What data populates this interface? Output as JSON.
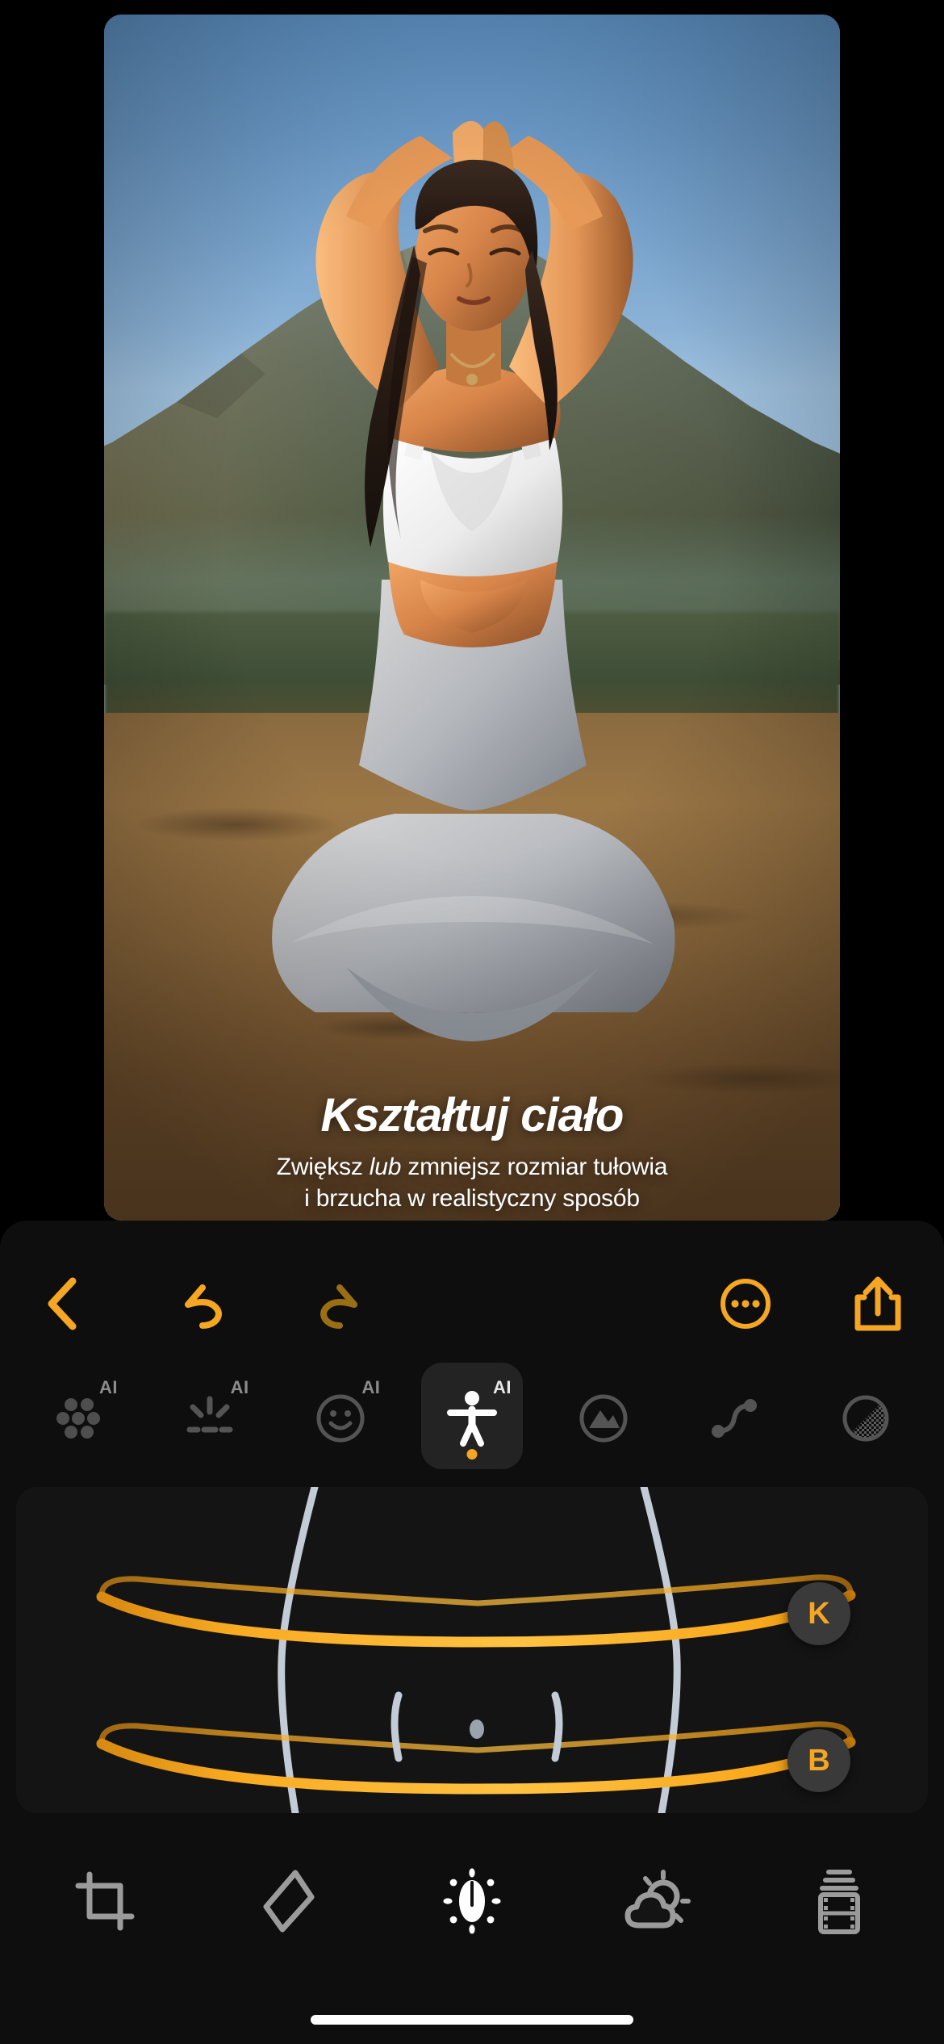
{
  "app": {
    "accent_color": "#f5a623",
    "sheet_bg": "#0e0e0e",
    "card_bg": "#141414"
  },
  "photo": {
    "caption": {
      "title": "Kształtuj ciało",
      "subtitle_line1_a": "Zwiększ ",
      "subtitle_line1_em": "lub",
      "subtitle_line1_b": " zmniejsz rozmiar tułowia",
      "subtitle_line2": "i brzucha w realistyczny sposób"
    }
  },
  "toolbar": {
    "back_label": "back-chevron",
    "undo_label": "undo",
    "redo_label": "redo",
    "more_label": "more-options",
    "share_label": "share"
  },
  "ai_tools": {
    "badge_text": "AI",
    "items": [
      {
        "name": "skin-retouch",
        "icon": "dots-cluster-icon",
        "ai": true,
        "active": false
      },
      {
        "name": "teeth-whiten",
        "icon": "sparkle-teeth-icon",
        "ai": true,
        "active": false
      },
      {
        "name": "face-reshape",
        "icon": "smiley-face-icon",
        "ai": true,
        "active": false
      },
      {
        "name": "body-reshape",
        "icon": "body-person-icon",
        "ai": true,
        "active": true
      },
      {
        "name": "sky-replace",
        "icon": "landscape-circle-icon",
        "ai": false,
        "active": false
      },
      {
        "name": "curves",
        "icon": "curve-points-icon",
        "ai": false,
        "active": false
      },
      {
        "name": "transparency",
        "icon": "halftone-circle-icon",
        "ai": false,
        "active": false
      }
    ]
  },
  "shape_editor": {
    "handles": [
      {
        "id": "waist",
        "label": "K"
      },
      {
        "id": "belly",
        "label": "B"
      }
    ]
  },
  "bottom_nav": {
    "items": [
      {
        "name": "crop",
        "icon": "crop-icon",
        "active": false
      },
      {
        "name": "heal",
        "icon": "eraser-icon",
        "active": false
      },
      {
        "name": "adjust",
        "icon": "brightness-icon",
        "active": true
      },
      {
        "name": "effects",
        "icon": "weather-icon",
        "active": false
      },
      {
        "name": "filters",
        "icon": "film-roll-icon",
        "active": false
      }
    ]
  }
}
